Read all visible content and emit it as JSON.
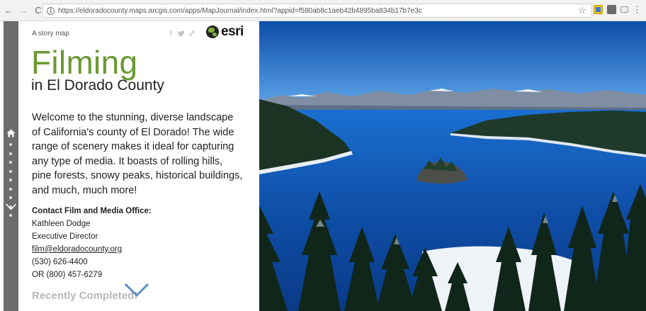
{
  "browser": {
    "back": "←",
    "forward": "→",
    "reload": "C",
    "info": "i",
    "url": "https://eldoradocounty.maps.arcgis.com/apps/MapJournal/index.html?appid=f580ab8c1aeb42b4895ba834b17b7e3c",
    "star": "☆",
    "menu": "⋮"
  },
  "rail": {
    "dot_count": 9,
    "icons": [
      "home-icon",
      "chevron-down-icon"
    ]
  },
  "header": {
    "story_map_label": "A story map",
    "share_icons": [
      "facebook-icon",
      "twitter-icon",
      "link-icon"
    ],
    "logo_text": "esri"
  },
  "story": {
    "title": "Filming",
    "subtitle": "in El Dorado County",
    "intro": "Welcome to the stunning, diverse landscape of California's county of El Dorado! The wide range of scenery makes it ideal for capturing any type of media. It boasts of rolling hills, pine forests, snowy peaks, historical buildings, and much, much more!",
    "contact_heading": "Contact Film and Media Office:",
    "contact_name": "Kathleen Dodge",
    "contact_title": "Executive Director",
    "contact_email": "film@eldoradocounty.org",
    "contact_phone": "(530) 626-4400",
    "contact_phone_alt": "OR (800) 457-6279",
    "recently_completed": "Recently Completed!"
  },
  "colors": {
    "title_green": "#6a9a32",
    "rail_gray": "#6c6c6c",
    "water_blue": "#0f4fa8",
    "sky_blue": "#1e6ccf"
  }
}
